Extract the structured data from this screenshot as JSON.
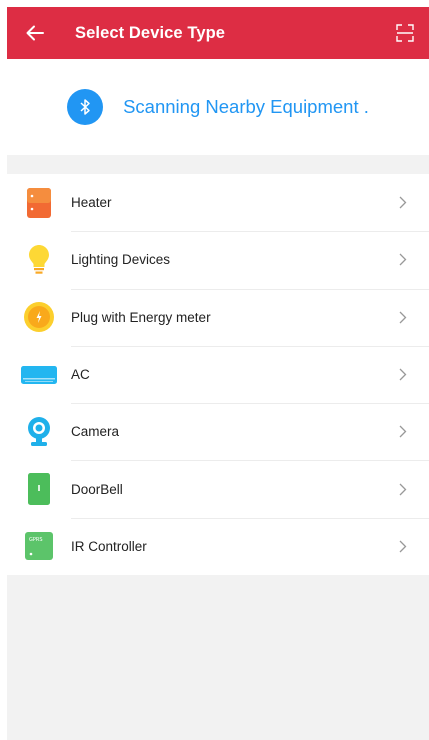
{
  "header": {
    "title": "Select Device Type"
  },
  "scan": {
    "text": "Scanning Nearby Equipment ."
  },
  "devices": [
    {
      "label": "Heater",
      "icon": "heater-icon"
    },
    {
      "label": "Lighting Devices",
      "icon": "light-bulb-icon"
    },
    {
      "label": "Plug with Energy meter",
      "icon": "plug-icon"
    },
    {
      "label": "AC",
      "icon": "air-conditioner-icon"
    },
    {
      "label": "Camera",
      "icon": "camera-icon"
    },
    {
      "label": "DoorBell",
      "icon": "doorbell-icon"
    },
    {
      "label": "IR Controller",
      "icon": "ir-controller-icon",
      "icon_text": "GPRS"
    }
  ],
  "colors": {
    "header": "#dd2d44",
    "accent": "#2196f3",
    "background": "#f2f2f2"
  }
}
